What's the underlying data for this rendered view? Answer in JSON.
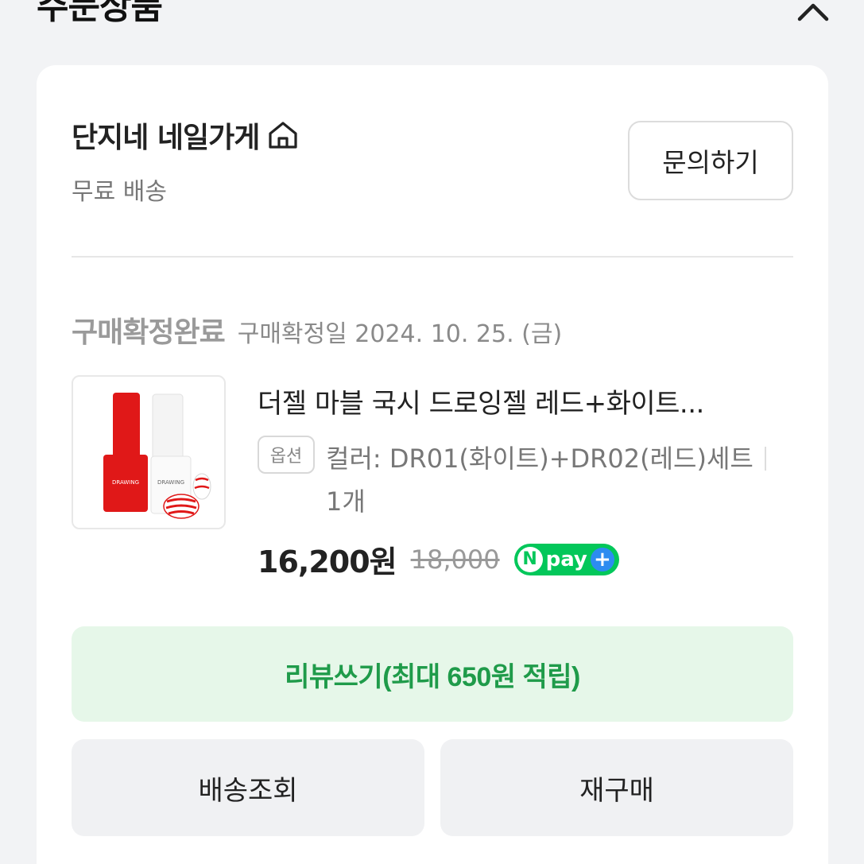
{
  "section": {
    "title": "주문상품"
  },
  "store": {
    "name": "단지네 네일가게",
    "shipping": "무료 배송",
    "inquiry_label": "문의하기"
  },
  "order": {
    "status": "구매확정완료",
    "confirm_date": "구매확정일 2024. 10. 25. (금)"
  },
  "product": {
    "title": "더젤 마블 국시 드로잉젤 레드+화이트...",
    "option_badge": "옵션",
    "option_text": "컬러: DR01(화이트)+DR02(레드)세트",
    "quantity": "1개",
    "sale_price": "16,200원",
    "original_price": "18,000",
    "npay_letter": "N",
    "npay_text": "pay",
    "npay_plus": "+",
    "thumb_label": "DRAWING"
  },
  "actions": {
    "review_label": "리뷰쓰기(최대 650원 적립)",
    "track_label": "배송조회",
    "rebuy_label": "재구매"
  },
  "colors": {
    "accent_green": "#1f9b4a",
    "review_bg": "#e6f7e9",
    "npay_green": "#03c75a"
  }
}
